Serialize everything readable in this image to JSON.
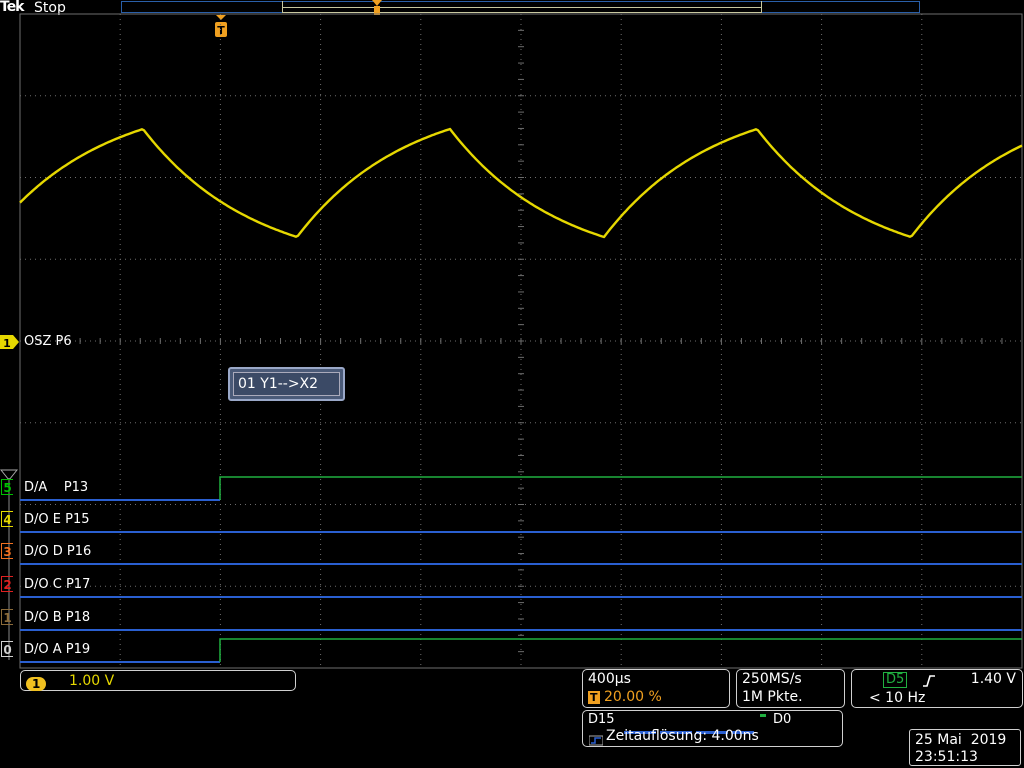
{
  "header": {
    "brand": "Tek",
    "acquisition_state": "Stop",
    "trigger_marker": "T"
  },
  "analog_channel": {
    "number": "1",
    "label": "OSZ P6",
    "color": "#e6d800",
    "vertical_scale": "1.00 V"
  },
  "bus_decode": {
    "text": "01 Y1-->X2"
  },
  "digital_channels": [
    {
      "num": "5",
      "label": "D/A    P13",
      "badge_color": "#00c000"
    },
    {
      "num": "4",
      "label": "D/O E P15",
      "badge_color": "#e6d800"
    },
    {
      "num": "3",
      "label": "D/O D P16",
      "badge_color": "#f07020"
    },
    {
      "num": "2",
      "label": "D/O C P17",
      "badge_color": "#e02020"
    },
    {
      "num": "1",
      "label": "D/O B P18",
      "badge_color": "#8b6b3a"
    },
    {
      "num": "0",
      "label": "D/O A P19",
      "badge_color": "#d0d0d0"
    }
  ],
  "colors": {
    "high": "#20b040",
    "low": "#2a5fd0",
    "grid": "#6e6e6e"
  },
  "timebase": {
    "time_per_div": "400µs",
    "trigger_position_marker": "T",
    "trigger_position": "20.00 %"
  },
  "acquisition": {
    "sample_rate": "250MS/s",
    "record_length": "1M Pkte."
  },
  "trigger": {
    "source": "D5",
    "slope_icon": "rising-edge-icon",
    "level": "1.40 V",
    "frequency": "< 10 Hz"
  },
  "digital_group": {
    "start": "D15",
    "end": "D0",
    "resolution_label": "Zeitauflösung: 4.00ns"
  },
  "datetime": {
    "date": "25 Mai  2019",
    "time": "23:51:13"
  }
}
